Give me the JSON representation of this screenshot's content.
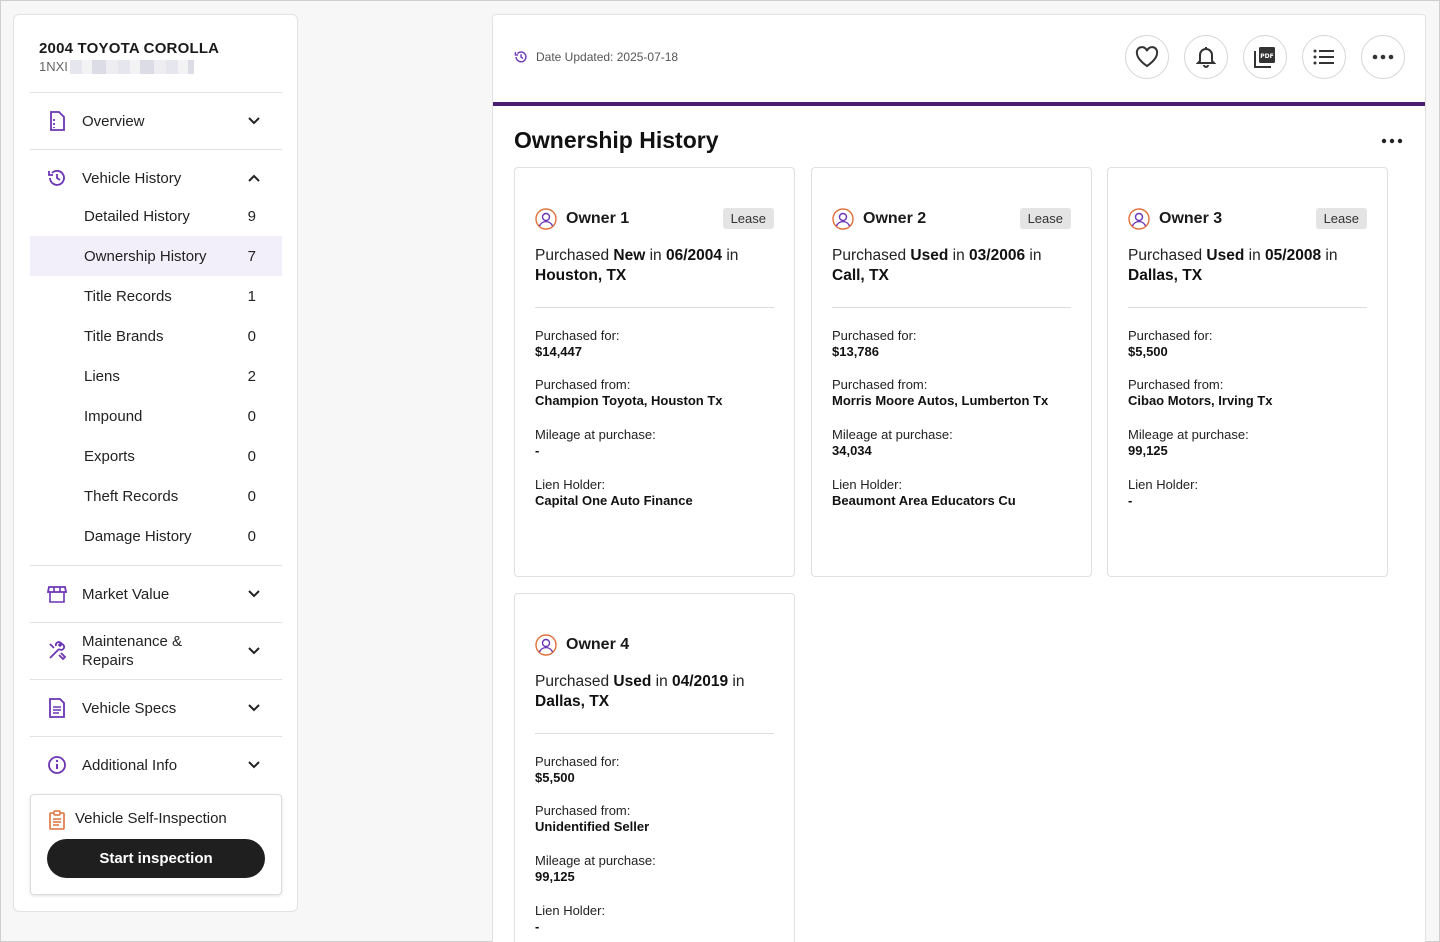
{
  "vehicle": {
    "title": "2004 TOYOTA COROLLA",
    "vin_prefix": "1NXI"
  },
  "sidebar": {
    "overview": "Overview",
    "vehicle_history": "Vehicle History",
    "sub_items": [
      {
        "label": "Detailed History",
        "count": "9"
      },
      {
        "label": "Ownership History",
        "count": "7"
      },
      {
        "label": "Title Records",
        "count": "1"
      },
      {
        "label": "Title Brands",
        "count": "0"
      },
      {
        "label": "Liens",
        "count": "2"
      },
      {
        "label": "Impound",
        "count": "0"
      },
      {
        "label": "Exports",
        "count": "0"
      },
      {
        "label": "Theft Records",
        "count": "0"
      },
      {
        "label": "Damage History",
        "count": "0"
      }
    ],
    "market_value": "Market Value",
    "maintenance_line1": "Maintenance &",
    "maintenance_line2": "Repairs",
    "vehicle_specs": "Vehicle Specs",
    "additional_info": "Additional Info",
    "inspection_title": "Vehicle Self-Inspection",
    "start_button": "Start inspection"
  },
  "header": {
    "date_updated": "Date Updated: 2025-07-18"
  },
  "section": {
    "title": "Ownership History"
  },
  "labels": {
    "purchased_for": "Purchased for:",
    "purchased_from": "Purchased from:",
    "mileage": "Mileage at purchase:",
    "lien_holder": "Lien Holder:",
    "purchased": "Purchased",
    "in": "in"
  },
  "owners": [
    {
      "name": "Owner 1",
      "badge": "Lease",
      "condition": "New",
      "date": "06/2004",
      "location": "Houston, TX",
      "price": "$14,447",
      "from": "Champion Toyota, Houston Tx",
      "mileage": "-",
      "lien": "Capital One Auto Finance"
    },
    {
      "name": "Owner 2",
      "badge": "Lease",
      "condition": "Used",
      "date": "03/2006",
      "location": "Call, TX",
      "price": "$13,786",
      "from": "Morris Moore Autos, Lumberton Tx",
      "mileage": "34,034",
      "lien": "Beaumont Area Educators Cu"
    },
    {
      "name": "Owner 3",
      "badge": "Lease",
      "condition": "Used",
      "date": "05/2008",
      "location": "Dallas, TX",
      "price": "$5,500",
      "from": "Cibao Motors, Irving Tx",
      "mileage": "99,125",
      "lien": "-"
    },
    {
      "name": "Owner 4",
      "badge": "",
      "condition": "Used",
      "date": "04/2019",
      "location": "Dallas, TX",
      "price": "$5,500",
      "from": "Unidentified Seller",
      "mileage": "99,125",
      "lien": "-"
    }
  ],
  "colors": {
    "accent": "#6b35b5",
    "bar": "#4a1f72",
    "owner_icon": "#e0703a"
  }
}
